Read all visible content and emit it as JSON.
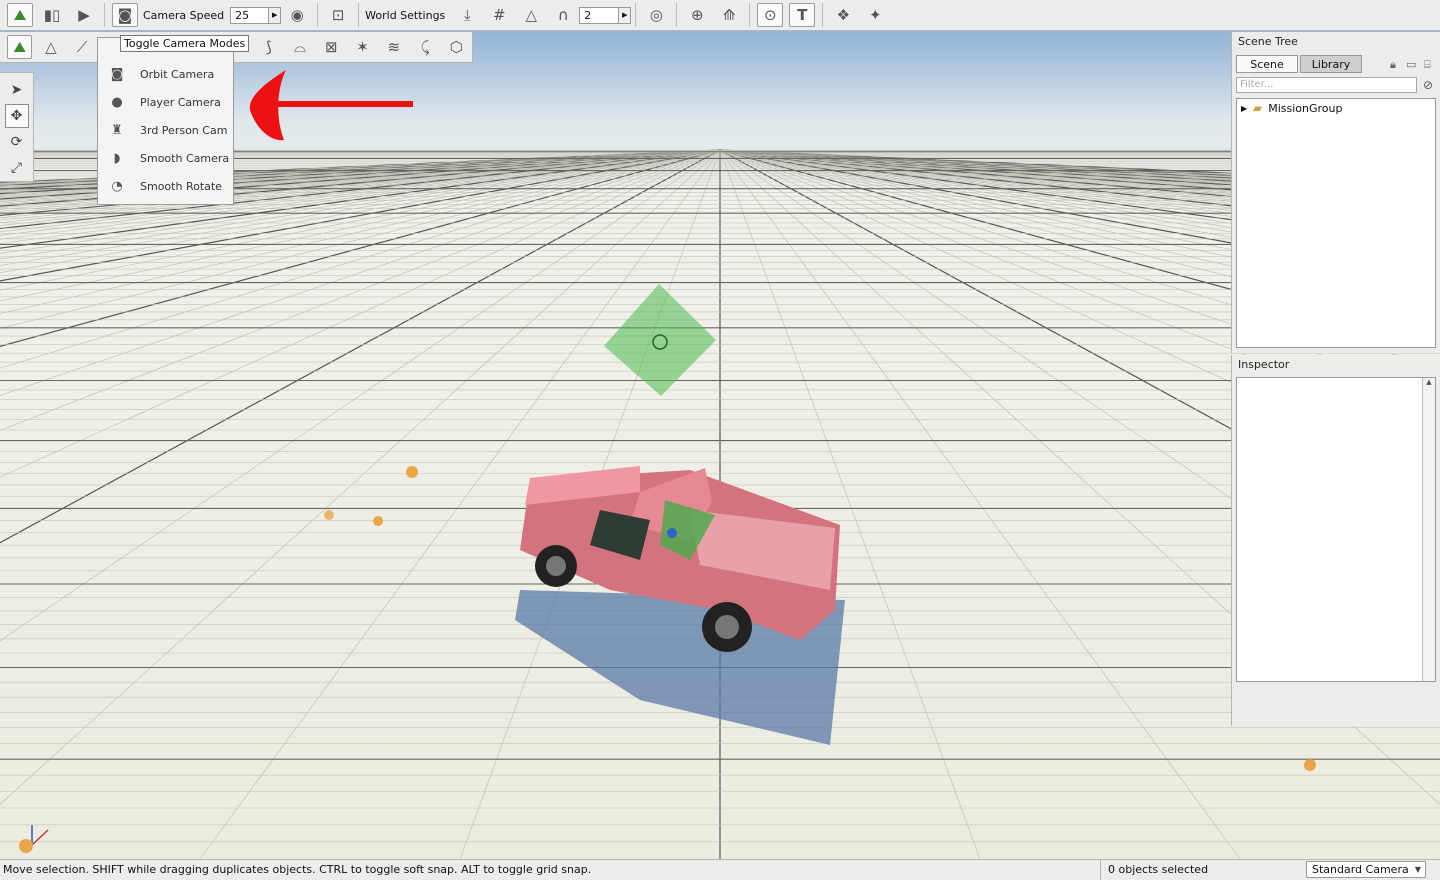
{
  "toolbar_top": {
    "camera_speed_label": "Camera Speed",
    "camera_speed_value": "25",
    "world_settings_label": "World Settings",
    "snap_value": "2"
  },
  "tooltip": {
    "text": "Toggle Camera Modes"
  },
  "camera_menu": {
    "items": [
      {
        "label": "Orbit Camera",
        "icon": "orbit-camera-icon"
      },
      {
        "label": "Player Camera",
        "icon": "player-camera-icon"
      },
      {
        "label": "3rd Person Cam",
        "icon": "third-person-cam-icon"
      },
      {
        "label": "Smooth Camera",
        "icon": "smooth-camera-icon"
      },
      {
        "label": "Smooth Rotate",
        "icon": "smooth-rotate-icon"
      }
    ]
  },
  "scene_tree": {
    "title": "Scene Tree",
    "tabs": [
      "Scene",
      "Library"
    ],
    "filter_placeholder": "Filter...",
    "root_item": "MissionGroup"
  },
  "inspector": {
    "title": "Inspector"
  },
  "statusbar": {
    "message": "Move selection.  SHIFT while dragging duplicates objects.  CTRL to toggle soft snap.  ALT to toggle grid snap.",
    "selection_count": "0 objects selected",
    "camera_mode": "Standard Camera"
  },
  "colors": {
    "truck_body": "#e07d87",
    "selection_green": "#4dbb4d",
    "annotation_red": "#ee1111"
  }
}
